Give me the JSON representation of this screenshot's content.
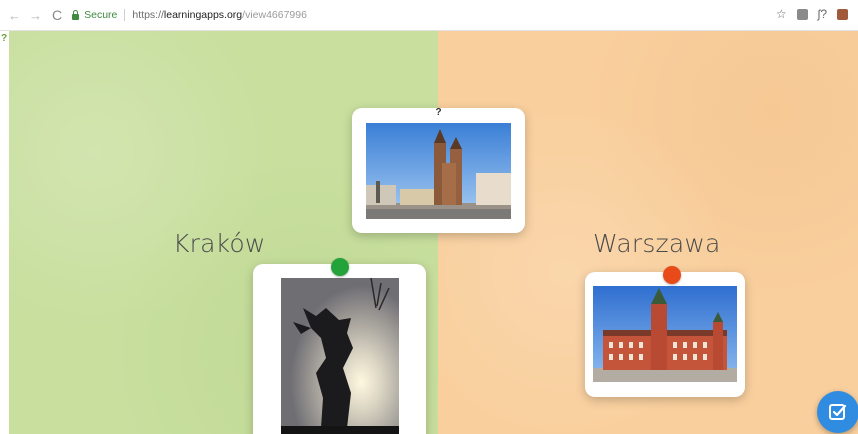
{
  "browser": {
    "secure_label": "Secure",
    "url_scheme": "https://",
    "url_host": "learningapps.org",
    "url_path": "/view4667996",
    "icons": [
      "back-icon",
      "forward-icon",
      "reload-icon",
      "lock-icon",
      "star-icon",
      "extension-icon",
      "extension-icon",
      "extension-icon"
    ]
  },
  "game": {
    "help_mark": "?",
    "zones": [
      {
        "label": "Kraków",
        "color": "#c8df9e"
      },
      {
        "label": "Warszawa",
        "color": "#f9cf9d"
      }
    ],
    "question_card": {
      "marker": "?"
    },
    "pins": {
      "green": "#24a33a",
      "red": "#e84a1a"
    },
    "check_button_color": "#2f8ce0"
  }
}
